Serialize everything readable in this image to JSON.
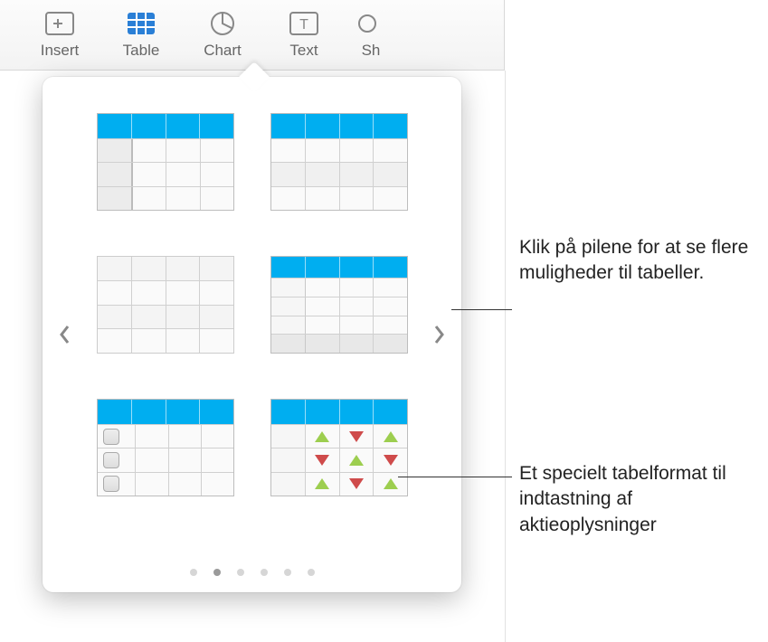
{
  "toolbar": {
    "insert": "Insert",
    "table": "Table",
    "chart": "Chart",
    "text": "Text",
    "shape": "Sh"
  },
  "callouts": {
    "arrows": "Klik på pilene for at se flere muligheder til tabeller.",
    "stocks": "Et specielt tabelformat til indtastning af aktieoplysninger"
  },
  "popover": {
    "page_count": 6,
    "active_page_index": 1
  }
}
